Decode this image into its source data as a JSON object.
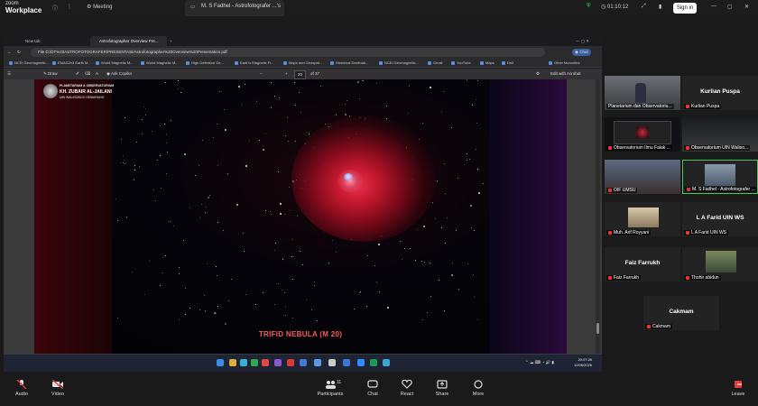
{
  "zoom": {
    "logo_top": "zoom",
    "logo_bottom": "Workplace",
    "meeting_label": "Meeting",
    "tab_title": "M. S Fadhel - Astrofotografer ...'s",
    "timer": "01:10:12",
    "sign_in": "Sign in"
  },
  "browser": {
    "tabs": [
      "New tab",
      "Astrofotographer Overview Pre..."
    ],
    "url": "File  D:/DT%20ASTROFOTOGRAFER/PRESENTASI/Astrofotographer%20Overview%20Presentation.pdf",
    "bookmarks": [
      "NCEI Geomagnetic...",
      "EMAG2v3 Earth M...",
      "World Magnetic M...",
      "World Magnetic M...",
      "High Definition Ge...",
      "Earth's Magnetic Fi...",
      "Maps and Geospat...",
      "Historical Declinati...",
      "NCEI Geomagnetic...",
      "Gmail",
      "YouTube",
      "Maps",
      "Dell",
      "Other favourites"
    ],
    "pdf_toolbar": {
      "draw": "Draw",
      "ask_copilot": "Ask Copilot",
      "page_current": "20",
      "page_total": "of 37",
      "edit": "Edit with Acrobat",
      "zoom_minus": "−",
      "zoom_plus": "+"
    },
    "chat_label": "Chat"
  },
  "slide": {
    "logo_line1": "PLANETARIUM & OBSERVATORIUM",
    "logo_line2": "KH. ZUBAIR AL-JAILANI",
    "logo_line3": "UIN WALISONGO SEMARANG",
    "title": "TRIFID NEBULA (M 20)"
  },
  "taskbar": {
    "time": "20:07:26",
    "date": "12/06/2026"
  },
  "gallery": {
    "tiles": [
      {
        "caption": "Planetarium dan Observatoriu...",
        "video": true
      },
      {
        "caption": "Kurlian Puspa",
        "name": "Kurlian Puspa",
        "video": false
      },
      {
        "caption": "Observatorium Ilmu Falak ...",
        "video": true
      },
      {
        "caption": "Observatorium UIN Waliso...",
        "video": true
      },
      {
        "caption": "OIF UMSU",
        "video": true
      },
      {
        "caption": "M. S Fadhel - Astrofotografer ...",
        "video": true,
        "active": true
      },
      {
        "caption": "Muh. Arif Royyani",
        "video": true
      },
      {
        "caption": "L A Farid UIN WS",
        "name": "L A Farid UIN WS",
        "video": false
      },
      {
        "caption": "Faiz Farrukh",
        "name": "Faiz Farrukh",
        "video": false
      },
      {
        "caption": "Thohir abidun",
        "video": true
      },
      {
        "caption": "Cakmam",
        "name": "Cakmam",
        "video": false
      }
    ]
  },
  "controls": {
    "audio": "Audio",
    "video": "Video",
    "participants": "Participants",
    "participants_count": "11",
    "chat": "Chat",
    "react": "React",
    "share": "Share",
    "more": "More",
    "leave": "Leave"
  },
  "colors": {
    "accent_red": "#e33b3b",
    "active_border": "#3ecb5e",
    "slide_title": "#ff5a5a"
  }
}
